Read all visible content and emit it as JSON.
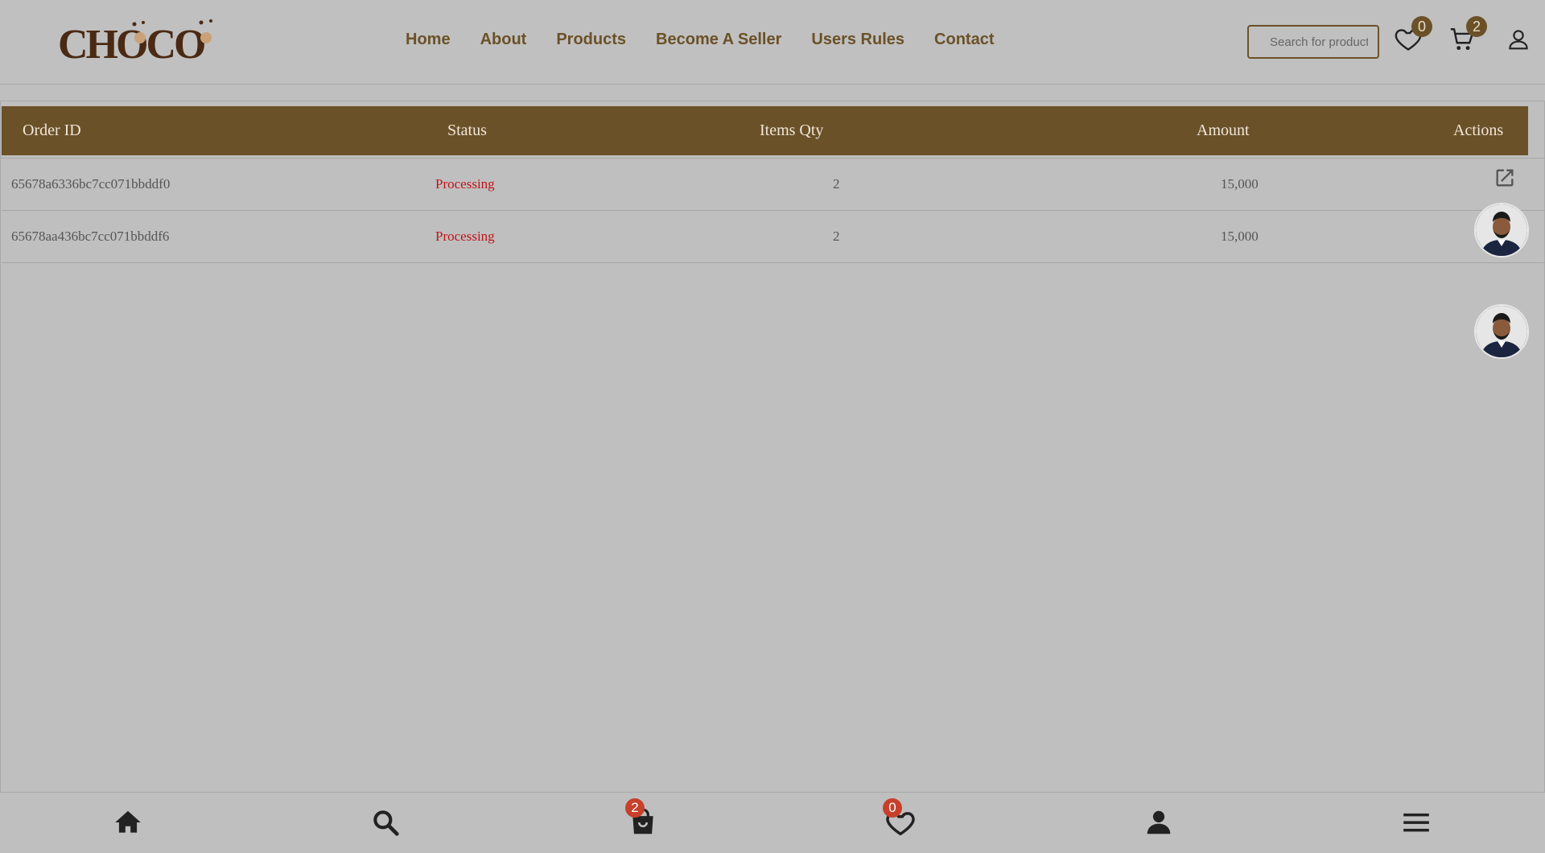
{
  "brand": {
    "logo_text": "CHOCO"
  },
  "nav": {
    "items": [
      {
        "label": "Home"
      },
      {
        "label": "About"
      },
      {
        "label": "Products"
      },
      {
        "label": "Become A Seller"
      },
      {
        "label": "Users Rules"
      },
      {
        "label": "Contact"
      }
    ]
  },
  "header": {
    "search_placeholder": "Search for products",
    "wishlist_count": "0",
    "cart_count": "2",
    "icons": [
      "heart-icon",
      "cart-icon",
      "user-icon"
    ]
  },
  "orders": {
    "columns": [
      "Order ID",
      "Status",
      "Items Qty",
      "Amount",
      "Actions"
    ],
    "rows": [
      {
        "id": "65678a6336bc7cc071bbddf0",
        "status": "Processing",
        "qty": "2",
        "amount": "15,000"
      },
      {
        "id": "65678aa436bc7cc071bbddf6",
        "status": "Processing",
        "qty": "2",
        "amount": "15,000"
      }
    ]
  },
  "bottom_nav": {
    "icons": [
      "home-icon",
      "search-icon",
      "shopping-bag-icon",
      "heart-icon",
      "user-icon",
      "menu-icon"
    ],
    "bag_count": "2",
    "wishlist_count": "0"
  },
  "colors": {
    "brand_brown": "#6b5128",
    "status_red": "#c0141a",
    "badge_red": "#c7402b",
    "background": "#bfbfbf"
  }
}
